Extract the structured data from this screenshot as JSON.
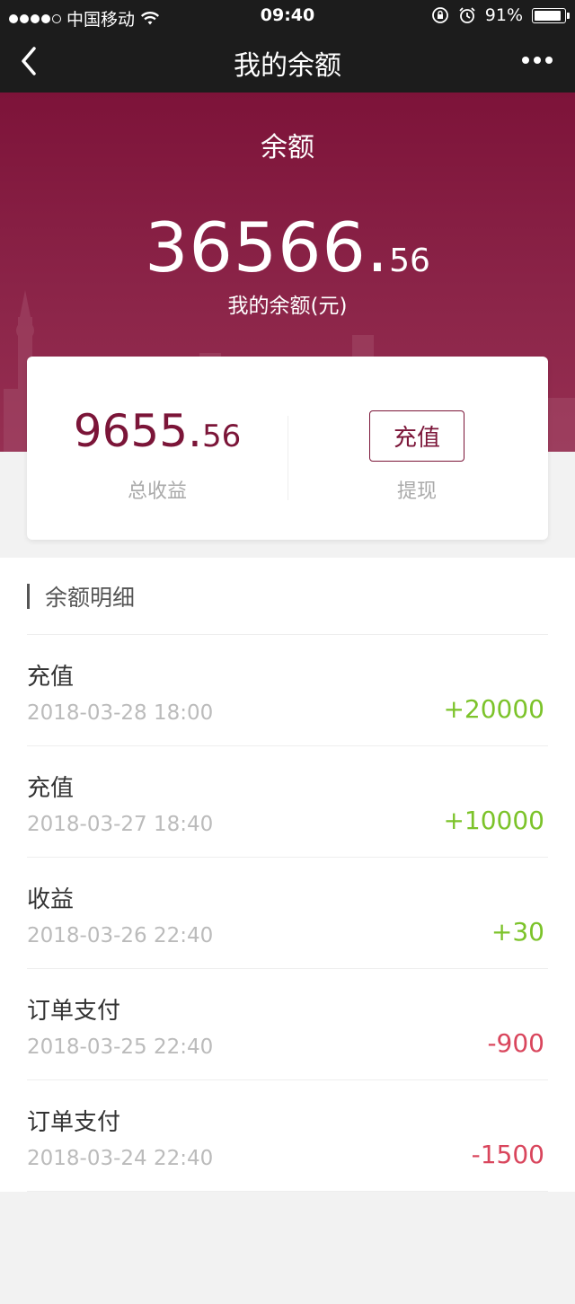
{
  "status_bar": {
    "carrier": "中国移动",
    "time": "09:40",
    "battery": "91%",
    "battery_level": 0.91
  },
  "nav": {
    "title": "我的余额"
  },
  "hero": {
    "label": "余额",
    "amount_int": "36566.",
    "amount_dec": "56",
    "caption": "我的余额(元)"
  },
  "card": {
    "income_int": "9655.",
    "income_dec": "56",
    "income_label": "总收益",
    "recharge_label": "充值",
    "withdraw_label": "提现"
  },
  "details": {
    "title": "余额明细",
    "rows": [
      {
        "type": "充值",
        "date": "2018-03-28 18:00",
        "amount": "+20000",
        "sign": "pos"
      },
      {
        "type": "充值",
        "date": "2018-03-27 18:40",
        "amount": "+10000",
        "sign": "pos"
      },
      {
        "type": "收益",
        "date": "2018-03-26 22:40",
        "amount": "+30",
        "sign": "pos"
      },
      {
        "type": "订单支付",
        "date": "2018-03-25 22:40",
        "amount": "-900",
        "sign": "neg"
      },
      {
        "type": "订单支付",
        "date": "2018-03-24 22:40",
        "amount": "-1500",
        "sign": "neg"
      }
    ]
  },
  "colors": {
    "brand": "#7b1538",
    "positive": "#7cc32a",
    "negative": "#d9465d"
  }
}
